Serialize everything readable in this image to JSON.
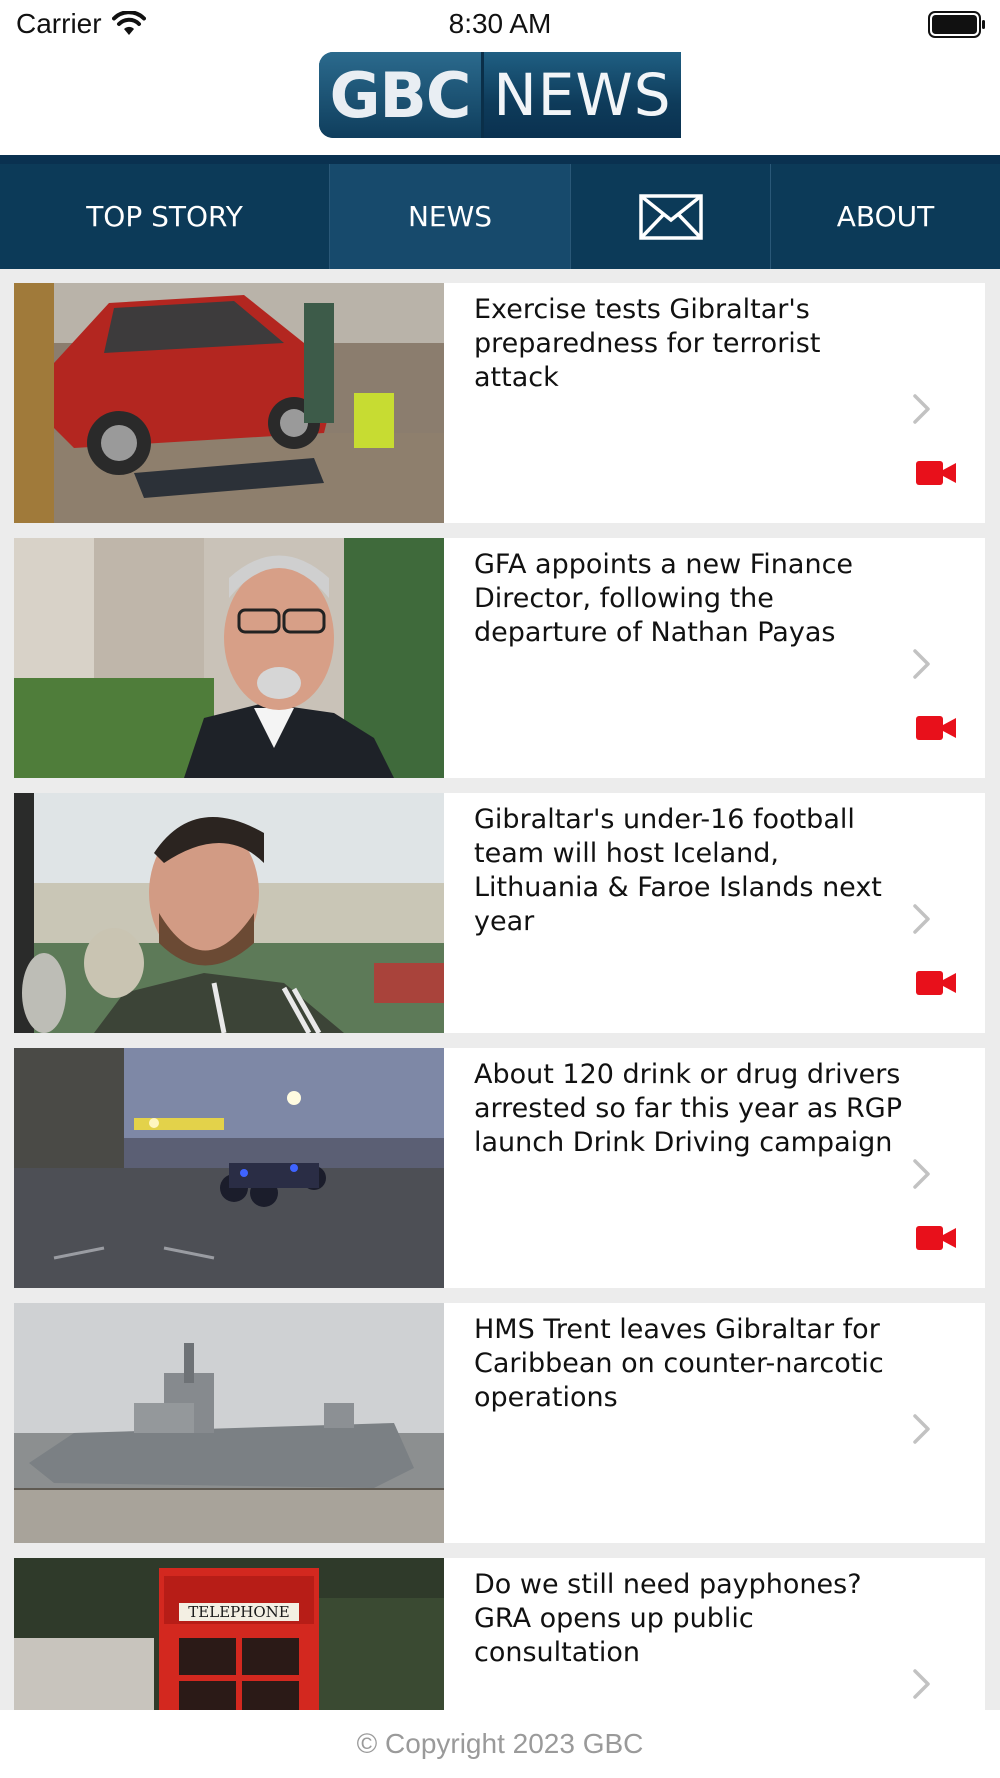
{
  "status_bar": {
    "carrier": "Carrier",
    "time": "8:30 AM"
  },
  "logo": {
    "left": "GBC",
    "right": "NEWS"
  },
  "nav": {
    "items": [
      {
        "label": "TOP STORY",
        "selected": false
      },
      {
        "label": "NEWS",
        "selected": true
      },
      {
        "label": "",
        "icon": "envelope-icon"
      },
      {
        "label": "ABOUT",
        "selected": false
      }
    ]
  },
  "stories": [
    {
      "headline": "Exercise tests Gibraltar's preparedness for terrorist attack",
      "has_video": true,
      "thumbnail": "crashed-red-car-emergency-drill"
    },
    {
      "headline": "GFA appoints a new Finance Director, following the departure of Nathan Payas",
      "has_video": true,
      "thumbnail": "man-with-glasses-portrait"
    },
    {
      "headline": "Gibraltar's under-16 football team will host Iceland, Lithuania & Faroe Islands next year",
      "has_video": true,
      "thumbnail": "young-man-with-trophies"
    },
    {
      "headline": "About 120 drink or drug drivers arrested so far this year as RGP launch Drink Driving campaign",
      "has_video": true,
      "thumbnail": "police-motorcycles-at-dusk"
    },
    {
      "headline": "HMS Trent leaves Gibraltar for Caribbean on counter-narcotic operations",
      "has_video": false,
      "thumbnail": "grey-naval-ship"
    },
    {
      "headline": "Do we still need payphones? GRA opens up public consultation",
      "has_video": false,
      "thumbnail": "red-telephone-box",
      "thumbnail_sign": "TELEPHONE"
    }
  ],
  "footer": {
    "copyright": "© Copyright 2023 GBC"
  },
  "colors": {
    "nav_bg": "#0c3a58",
    "nav_selected": "#174a6c",
    "video_icon": "#e8101b",
    "feed_bg": "#ececec"
  }
}
